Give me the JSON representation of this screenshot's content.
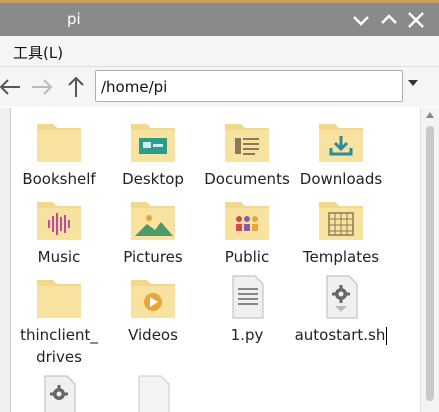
{
  "window": {
    "title": "pi"
  },
  "menubar": {
    "tools": "工具(L)"
  },
  "toolbar": {
    "path": "/home/pi"
  },
  "files": [
    {
      "name": "Bookshelf",
      "icon": "folder-icon"
    },
    {
      "name": "Desktop",
      "icon": "folder-desktop-icon"
    },
    {
      "name": "Documents",
      "icon": "folder-documents-icon"
    },
    {
      "name": "Downloads",
      "icon": "folder-downloads-icon"
    },
    {
      "name": "Music",
      "icon": "folder-music-icon"
    },
    {
      "name": "Pictures",
      "icon": "folder-pictures-icon"
    },
    {
      "name": "Public",
      "icon": "folder-public-icon"
    },
    {
      "name": "Templates",
      "icon": "folder-templates-icon"
    },
    {
      "name": "thinclient_drives",
      "icon": "folder-icon"
    },
    {
      "name": "Videos",
      "icon": "folder-videos-icon"
    },
    {
      "name": "1.py",
      "icon": "text-file-icon"
    },
    {
      "name": "autostart.sh",
      "icon": "script-file-icon"
    }
  ]
}
